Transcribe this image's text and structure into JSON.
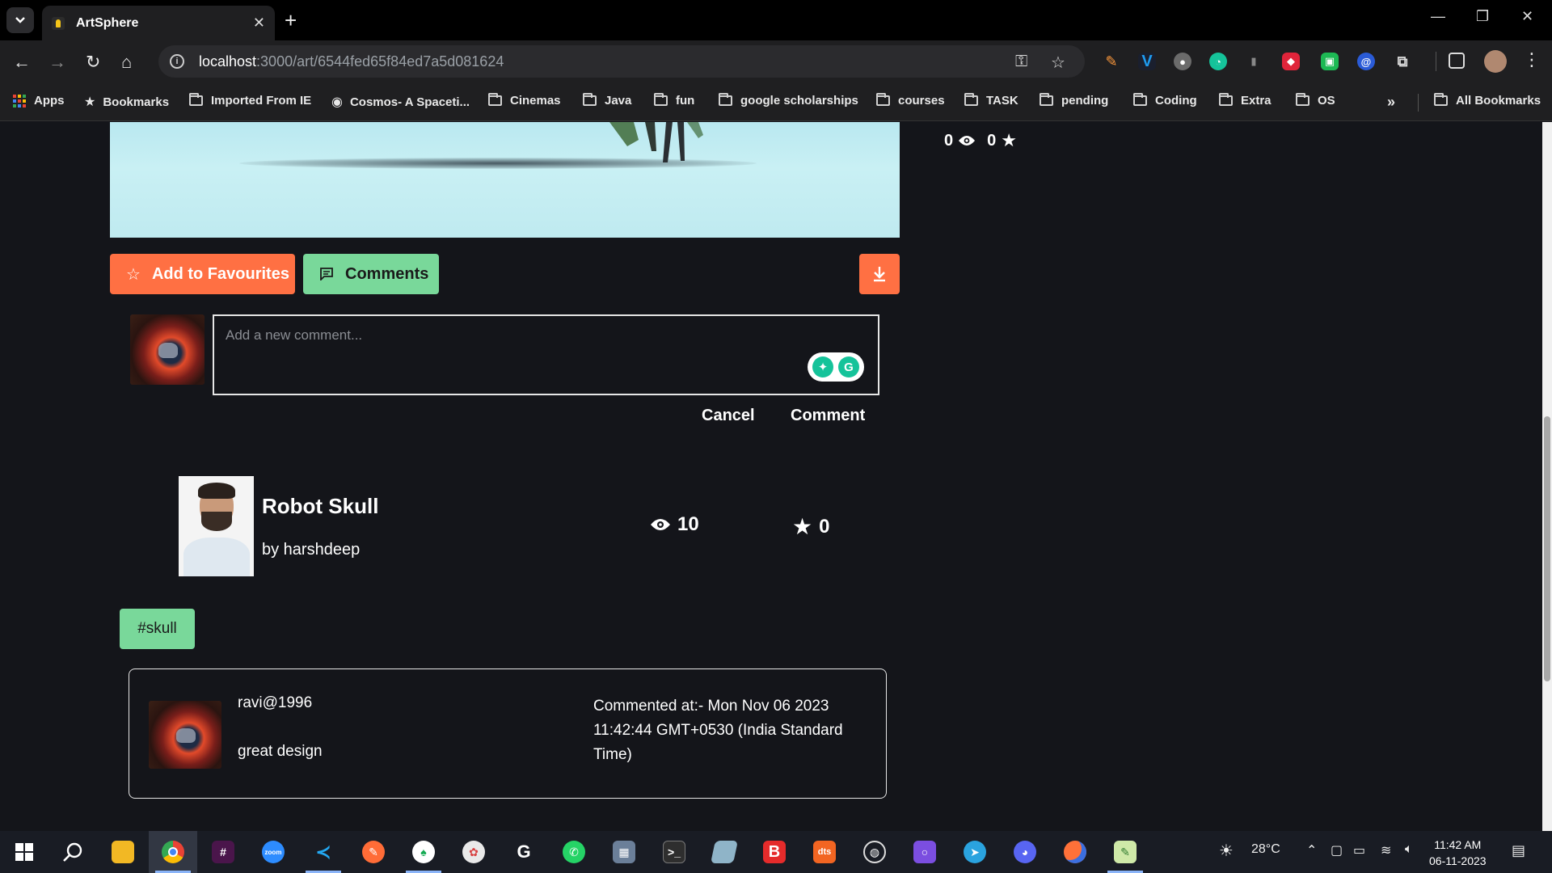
{
  "browser": {
    "tab_title": "ArtSphere",
    "url_host": "localhost",
    "url_path": ":3000/art/6544fed65f84ed7a5d081624",
    "bookmarks": [
      {
        "label": "Apps",
        "icon": "apps-grid-icon"
      },
      {
        "label": "Bookmarks",
        "icon": "star-icon"
      },
      {
        "label": "Imported From IE",
        "icon": "folder-icon"
      },
      {
        "label": "Cosmos- A Spaceti...",
        "icon": "globe-icon"
      },
      {
        "label": "Cinemas",
        "icon": "folder-icon"
      },
      {
        "label": "Java",
        "icon": "folder-icon"
      },
      {
        "label": "fun",
        "icon": "folder-icon"
      },
      {
        "label": "google scholarships",
        "icon": "folder-icon"
      },
      {
        "label": "courses",
        "icon": "folder-icon"
      },
      {
        "label": "TASK",
        "icon": "folder-icon"
      },
      {
        "label": "pending",
        "icon": "folder-icon"
      },
      {
        "label": "Coding",
        "icon": "folder-icon"
      },
      {
        "label": "Extra",
        "icon": "folder-icon"
      },
      {
        "label": "OS",
        "icon": "folder-icon"
      }
    ],
    "all_bookmarks": "All Bookmarks"
  },
  "art": {
    "header_views": "0",
    "header_stars": "0",
    "favourite_label": "Add to Favourites",
    "comments_label": "Comments",
    "title": "Robot Skull",
    "author": "by harshdeep",
    "views": "10",
    "stars": "0",
    "tag": "#skull"
  },
  "new_comment": {
    "placeholder": "Add a new comment...",
    "cancel_label": "Cancel",
    "submit_label": "Comment"
  },
  "comments": [
    {
      "user": "ravi@1996",
      "text": "great design",
      "time": "Commented at:- Mon Nov 06 2023 11:42:44 GMT+0530 (India Standard Time)"
    }
  ],
  "taskbar": {
    "weather": "28°C",
    "time": "11:42 AM",
    "date": "06-11-2023"
  },
  "colors": {
    "accent_orange": "#ff7043",
    "accent_green": "#79d89a",
    "page_bg": "#14151a"
  }
}
